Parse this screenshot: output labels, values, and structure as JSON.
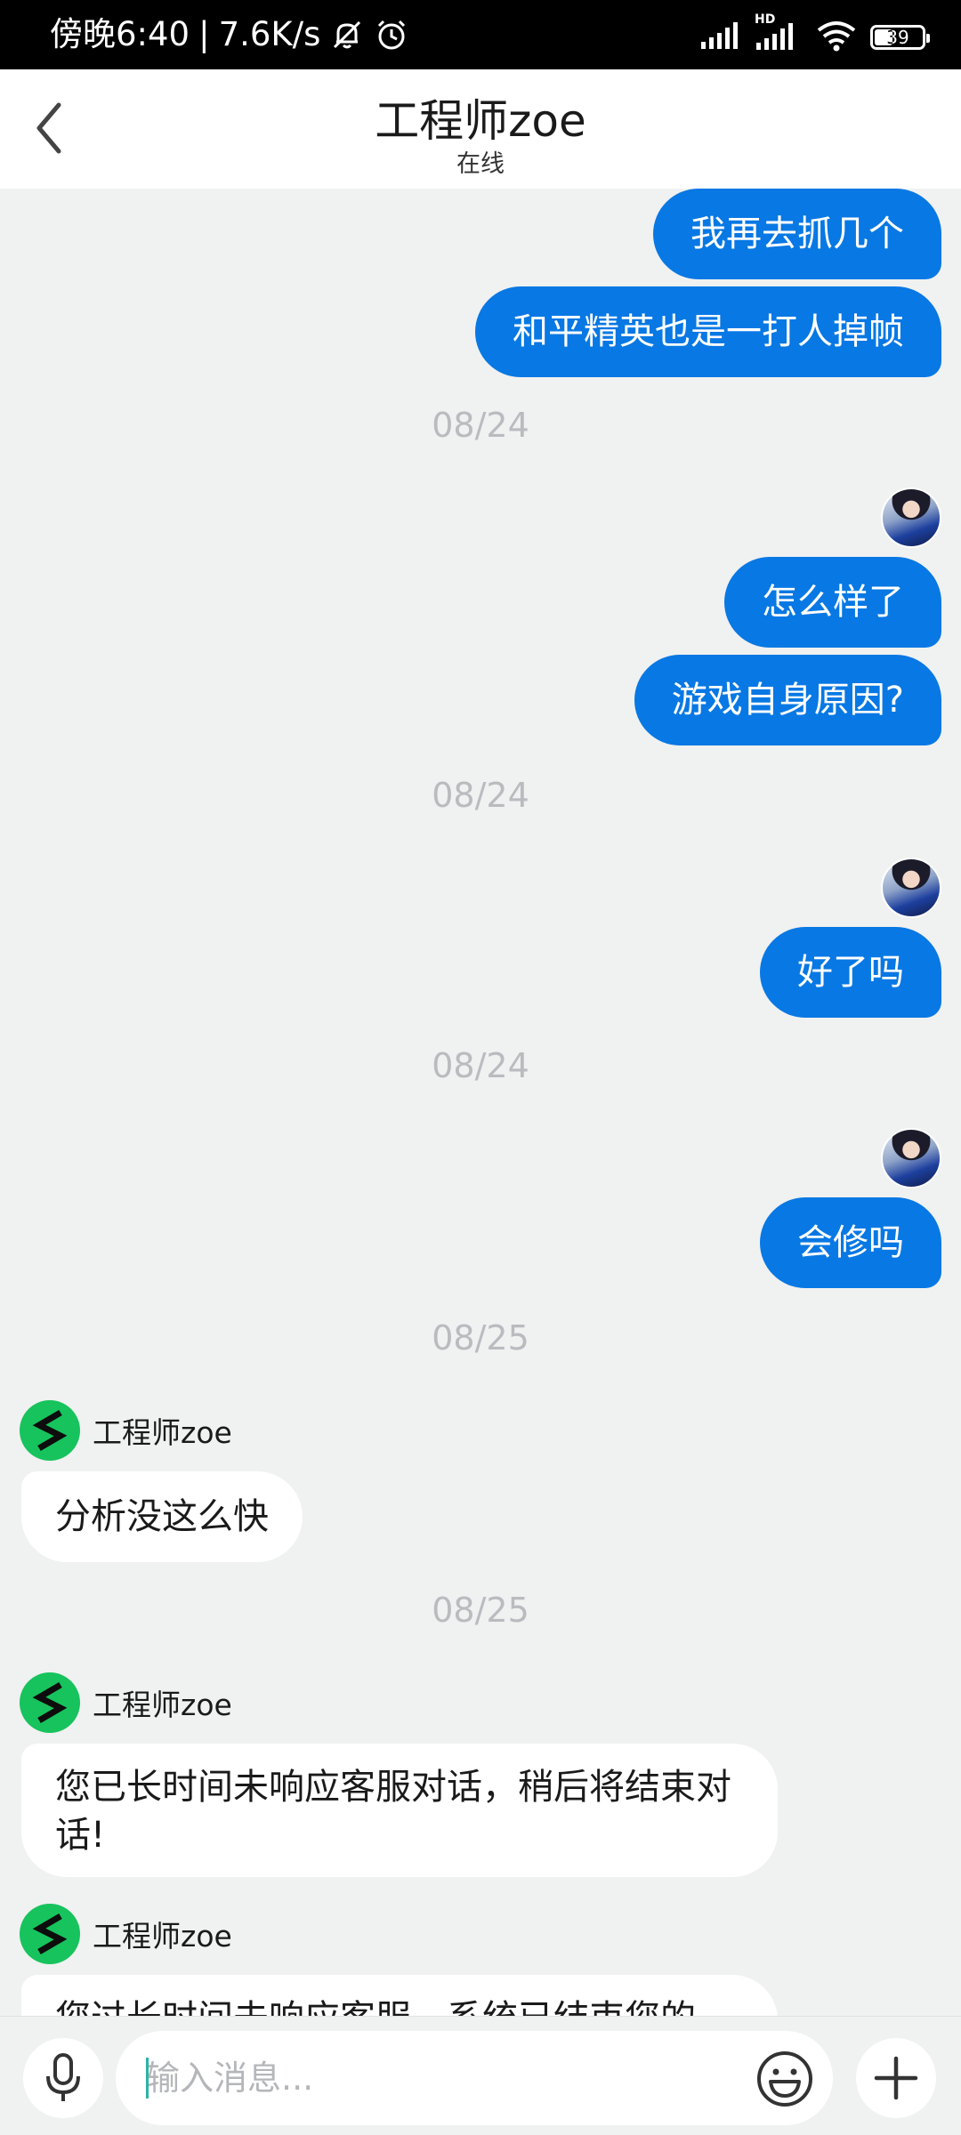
{
  "status_bar": {
    "time": "傍晚6:40",
    "speed": "7.6K/s",
    "battery": "39",
    "battery_level": 0.39,
    "hd_label": "HD"
  },
  "header": {
    "title": "工程师zoe",
    "subtitle": "在线",
    "back_icon": "chevron-left-icon"
  },
  "messages": {
    "out_1": "我再去抓几个",
    "out_2": "和平精英也是一打人掉帧",
    "date_1": "08/24",
    "out_3": "怎么样了",
    "out_4": "游戏自身原因?",
    "date_2": "08/24",
    "out_5": "好了吗",
    "date_3": "08/24",
    "out_6": "会修吗",
    "date_4": "08/25",
    "agent_name_1": "工程师zoe",
    "in_1": "分析没这么快",
    "date_5": "08/25",
    "agent_name_2": "工程师zoe",
    "in_2": "您已长时间未响应客服对话，稍后将结束对话!",
    "agent_name_3": "工程师zoe",
    "in_3": "您过长时间未响应客服，系统已结束您的"
  },
  "input_bar": {
    "placeholder": "输入消息...",
    "mic_icon": "microphone-icon",
    "emoji_icon": "emoji-icon",
    "plus_icon": "plus-icon"
  },
  "colors": {
    "outgoing_bubble": "#0878e4",
    "background": "#f0f1f1",
    "agent_avatar": "#17c35c"
  }
}
